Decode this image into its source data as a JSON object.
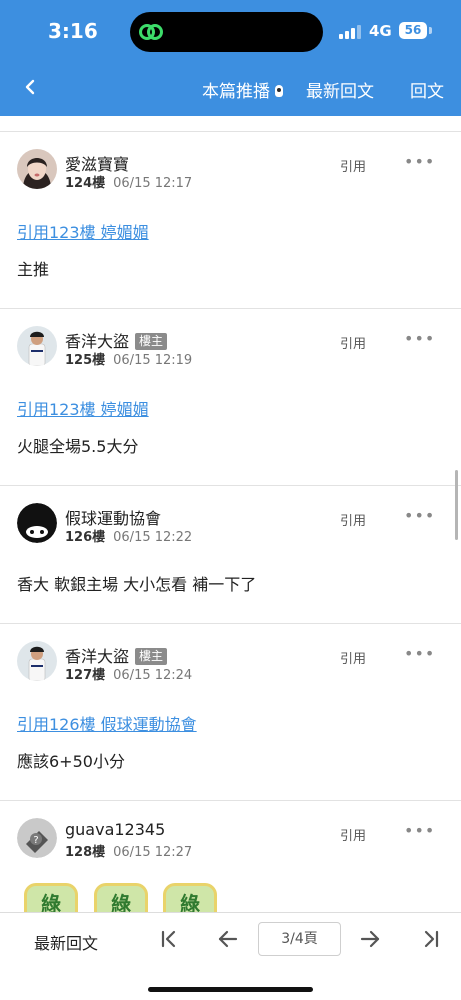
{
  "status_bar": {
    "time": "3:16",
    "network": "4G",
    "battery": "56"
  },
  "nav": {
    "back_icon": "chevron-left-icon",
    "featured": "本篇推播",
    "latest": "最新回文",
    "reply": "回文"
  },
  "posts": [
    {
      "username": "愛滋寶寶",
      "badge": "",
      "floor": "124樓",
      "time": "06/15 12:17",
      "quote_label": "引用",
      "more": "•••",
      "ref": "引用123樓 婷媚媚",
      "text": "主推"
    },
    {
      "username": "香洋大盜",
      "badge": "樓主",
      "floor": "125樓",
      "time": "06/15 12:19",
      "quote_label": "引用",
      "more": "•••",
      "ref": "引用123樓 婷媚媚",
      "text": "火腿全場5.5大分"
    },
    {
      "username": "假球運動協會",
      "badge": "",
      "floor": "126樓",
      "time": "06/15 12:22",
      "quote_label": "引用",
      "more": "•••",
      "ref": "",
      "text": "香大 軟銀主場 大小怎看 補一下了"
    },
    {
      "username": "香洋大盜",
      "badge": "樓主",
      "floor": "127樓",
      "time": "06/15 12:24",
      "quote_label": "引用",
      "more": "•••",
      "ref": "引用126樓 假球運動協會",
      "text": "應該6+50小分"
    },
    {
      "username": "guava12345",
      "badge": "",
      "floor": "128樓",
      "time": "06/15 12:27",
      "quote_label": "引用",
      "more": "•••",
      "ref": "",
      "text": ""
    }
  ],
  "stickers": [
    "綠",
    "綠",
    "綠"
  ],
  "bottom_bar": {
    "latest": "最新回文",
    "first_icon": "first-page-icon",
    "prev_icon": "arrow-left-icon",
    "page": "3/4頁",
    "next_icon": "arrow-right-icon",
    "last_icon": "last-page-icon"
  },
  "colors": {
    "header": "#3d8fe0",
    "link": "#3d8fe0",
    "badge": "#8b8b8b"
  }
}
